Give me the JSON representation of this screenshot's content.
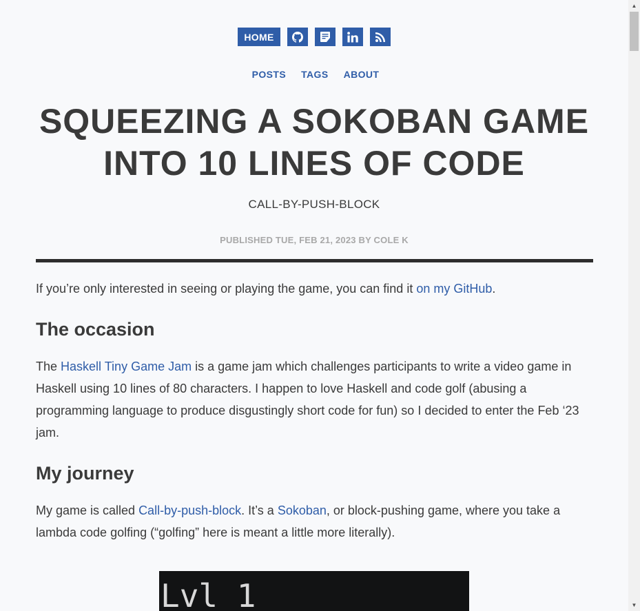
{
  "nav": {
    "home_label": "HOME",
    "icons": [
      "github-icon",
      "notes-icon",
      "linkedin-icon",
      "rss-icon"
    ]
  },
  "subnav": {
    "posts": "POSTS",
    "tags": "TAGS",
    "about": "ABOUT"
  },
  "article": {
    "title_line1": "SQUEEZING A SOKOBAN GAME",
    "title_line2": "INTO 10 LINES OF CODE",
    "subtitle": "CALL-BY-PUSH-BLOCK",
    "meta": "PUBLISHED TUE, FEB 21, 2023 BY COLE K",
    "intro_before": "If you’re only interested in seeing or playing the game, you can find it ",
    "intro_link": "on my GitHub",
    "intro_after": ".",
    "heading_occasion": "The occasion",
    "occasion_before": "The ",
    "occasion_link": "Haskell Tiny Game Jam",
    "occasion_after": " is a game jam which challenges participants to write a video game in Haskell using 10 lines of 80 characters. I happen to love Haskell and code golf (abusing a programming language to produce disgustingly short code for fun) so I decided to enter the Feb ‘23 jam.",
    "heading_journey": "My journey",
    "journey_before": "My game is called ",
    "journey_link1": "Call-by-push-block",
    "journey_mid": ". It’s a ",
    "journey_link2": "Sokoban",
    "journey_after": ", or block-pushing game, where you take a lambda code golfing (“golfing” here is meant a little more literally).",
    "game_image_text": "Lvl 1"
  },
  "colors": {
    "accent": "#2f5da8",
    "text": "#3a3a3a",
    "meta": "#a8a8a8",
    "background": "#f8f9fb",
    "rule": "#2d2d2d"
  }
}
